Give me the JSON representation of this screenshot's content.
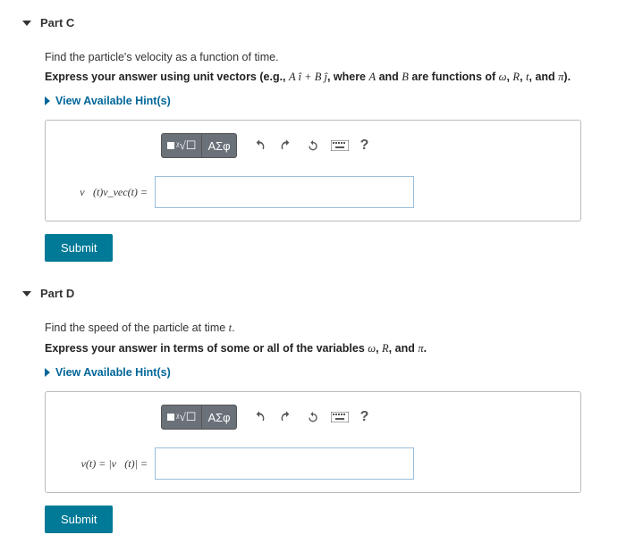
{
  "partC": {
    "title": "Part C",
    "prompt": "Find the particle's velocity as a function of time.",
    "instruction_prefix": "Express your answer using unit vectors (e.g., ",
    "instruction_mid": ", where ",
    "instruction_vars": "A and B are functions of ω, R, t, and π",
    "instruction_suffix": ").",
    "hints": "View Available Hint(s)",
    "var_label": "v⃗(t)v_vec(t) =",
    "submit": "Submit"
  },
  "partD": {
    "title": "Part D",
    "prompt": "Find the speed of the particle at time t.",
    "instruction": "Express your answer in terms of some or all of the variables ω, R, and π.",
    "hints": "View Available Hint(s)",
    "var_label": "v(t) = |v⃗(t)| =",
    "submit": "Submit"
  },
  "toolbar": {
    "templates_tooltip": "Templates",
    "symbols_label": "ΑΣφ",
    "undo_tooltip": "Undo",
    "redo_tooltip": "Redo",
    "reset_tooltip": "Reset",
    "keyboard_tooltip": "Keyboard",
    "help_label": "?"
  }
}
